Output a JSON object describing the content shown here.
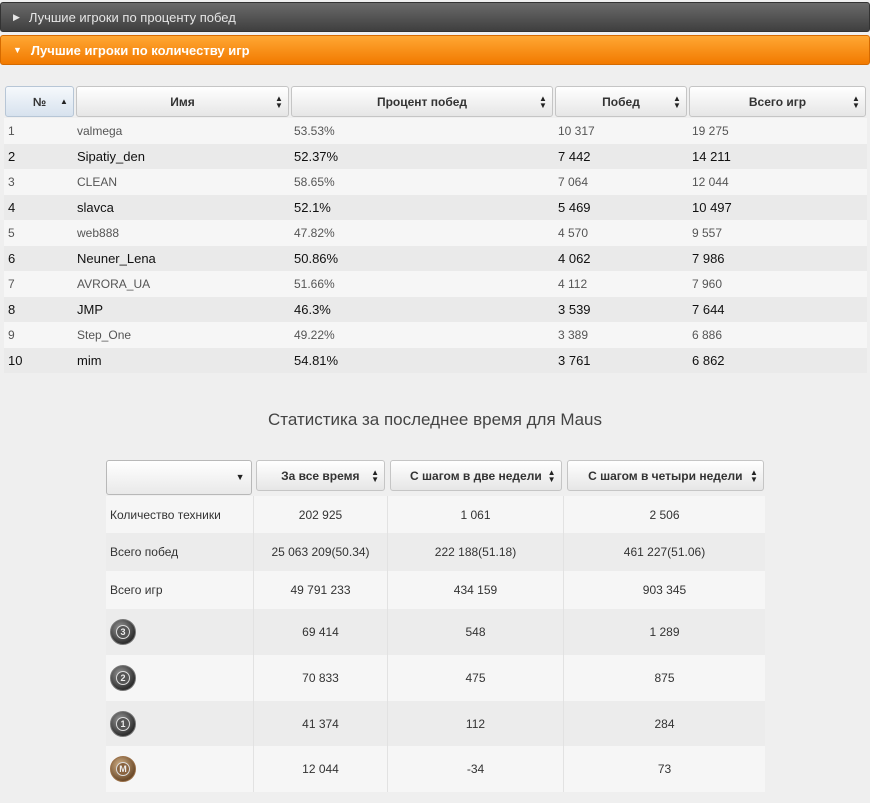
{
  "accordion": {
    "win_rate_title": "Лучшие игроки по проценту побед",
    "games_title": "Лучшие игроки по количеству игр"
  },
  "players_table": {
    "headers": [
      "№",
      "Имя",
      "Процент побед",
      "Побед",
      "Всего игр"
    ],
    "rows": [
      {
        "rank": "1",
        "name": "valmega",
        "win_pct": "53.53%",
        "wins": "10 317",
        "games": "19 275"
      },
      {
        "rank": "2",
        "name": "Sipatiy_den",
        "win_pct": "52.37%",
        "wins": "7 442",
        "games": "14 211"
      },
      {
        "rank": "3",
        "name": "CLEAN",
        "win_pct": "58.65%",
        "wins": "7 064",
        "games": "12 044"
      },
      {
        "rank": "4",
        "name": "slavca",
        "win_pct": "52.1%",
        "wins": "5 469",
        "games": "10 497"
      },
      {
        "rank": "5",
        "name": "web888",
        "win_pct": "47.82%",
        "wins": "4 570",
        "games": "9 557"
      },
      {
        "rank": "6",
        "name": "Neuner_Lena",
        "win_pct": "50.86%",
        "wins": "4 062",
        "games": "7 986"
      },
      {
        "rank": "7",
        "name": "AVRORA_UA",
        "win_pct": "51.66%",
        "wins": "4 112",
        "games": "7 960"
      },
      {
        "rank": "8",
        "name": "JMP",
        "win_pct": "46.3%",
        "wins": "3 539",
        "games": "7 644"
      },
      {
        "rank": "9",
        "name": "Step_One",
        "win_pct": "49.22%",
        "wins": "3 389",
        "games": "6 886"
      },
      {
        "rank": "10",
        "name": "mim",
        "win_pct": "54.81%",
        "wins": "3 761",
        "games": "6 862"
      }
    ]
  },
  "stats": {
    "title": "Статистика за последнее время для Maus",
    "select_value": "",
    "headers": [
      "За все время",
      "С шагом в две недели",
      "С шагом в четыри недели"
    ],
    "rows": [
      {
        "label": "Количество техники",
        "all": "202 925",
        "two_weeks": "1 061",
        "four_weeks": "2 506"
      },
      {
        "label": "Всего побед",
        "all": "25 063 209(50.34)",
        "two_weeks": "222 188(51.18)",
        "four_weeks": "461 227(51.06)"
      },
      {
        "label": "Всего игр",
        "all": "49 791 233",
        "two_weeks": "434 159",
        "four_weeks": "903 345"
      }
    ],
    "medal_rows": [
      {
        "medal": "3",
        "all": "69 414",
        "two_weeks": "548",
        "four_weeks": "1 289"
      },
      {
        "medal": "2",
        "all": "70 833",
        "two_weeks": "475",
        "four_weeks": "875"
      },
      {
        "medal": "1",
        "all": "41 374",
        "two_weeks": "112",
        "four_weeks": "284"
      },
      {
        "medal": "M",
        "all": "12 044",
        "two_weeks": "-34",
        "four_weeks": "73"
      }
    ]
  }
}
